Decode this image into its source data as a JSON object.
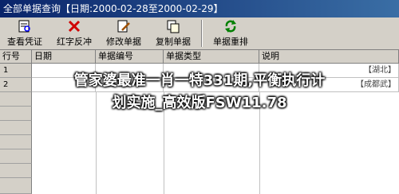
{
  "window": {
    "title": "全部单据查询【日期:2000-02-28至2000-02-29】"
  },
  "toolbar": {
    "buttons": [
      {
        "label": "查看凭证",
        "icon": "view-voucher-icon"
      },
      {
        "label": "红字反冲",
        "icon": "red-x-icon"
      },
      {
        "label": "修改单据",
        "icon": "edit-document-icon"
      },
      {
        "label": "复制单据",
        "icon": "copy-document-icon"
      },
      {
        "label": "单据重排",
        "icon": "refresh-icon"
      }
    ]
  },
  "grid": {
    "columns": [
      "行号",
      "日期",
      "单据编号",
      "单据类型",
      "说明"
    ],
    "rows": [
      {
        "row_no": "1",
        "note": "【湖北】"
      },
      {
        "row_no": "2",
        "note": "【成都武】"
      }
    ]
  },
  "overlay": {
    "line1": "管家婆最准一肖一特331期,平衡执行计",
    "line2": "划实施_高效版FSW11.78"
  },
  "colors": {
    "titlebar": "#0a246a",
    "face": "#d4d0c8",
    "grid_bg": "#ffffff"
  }
}
